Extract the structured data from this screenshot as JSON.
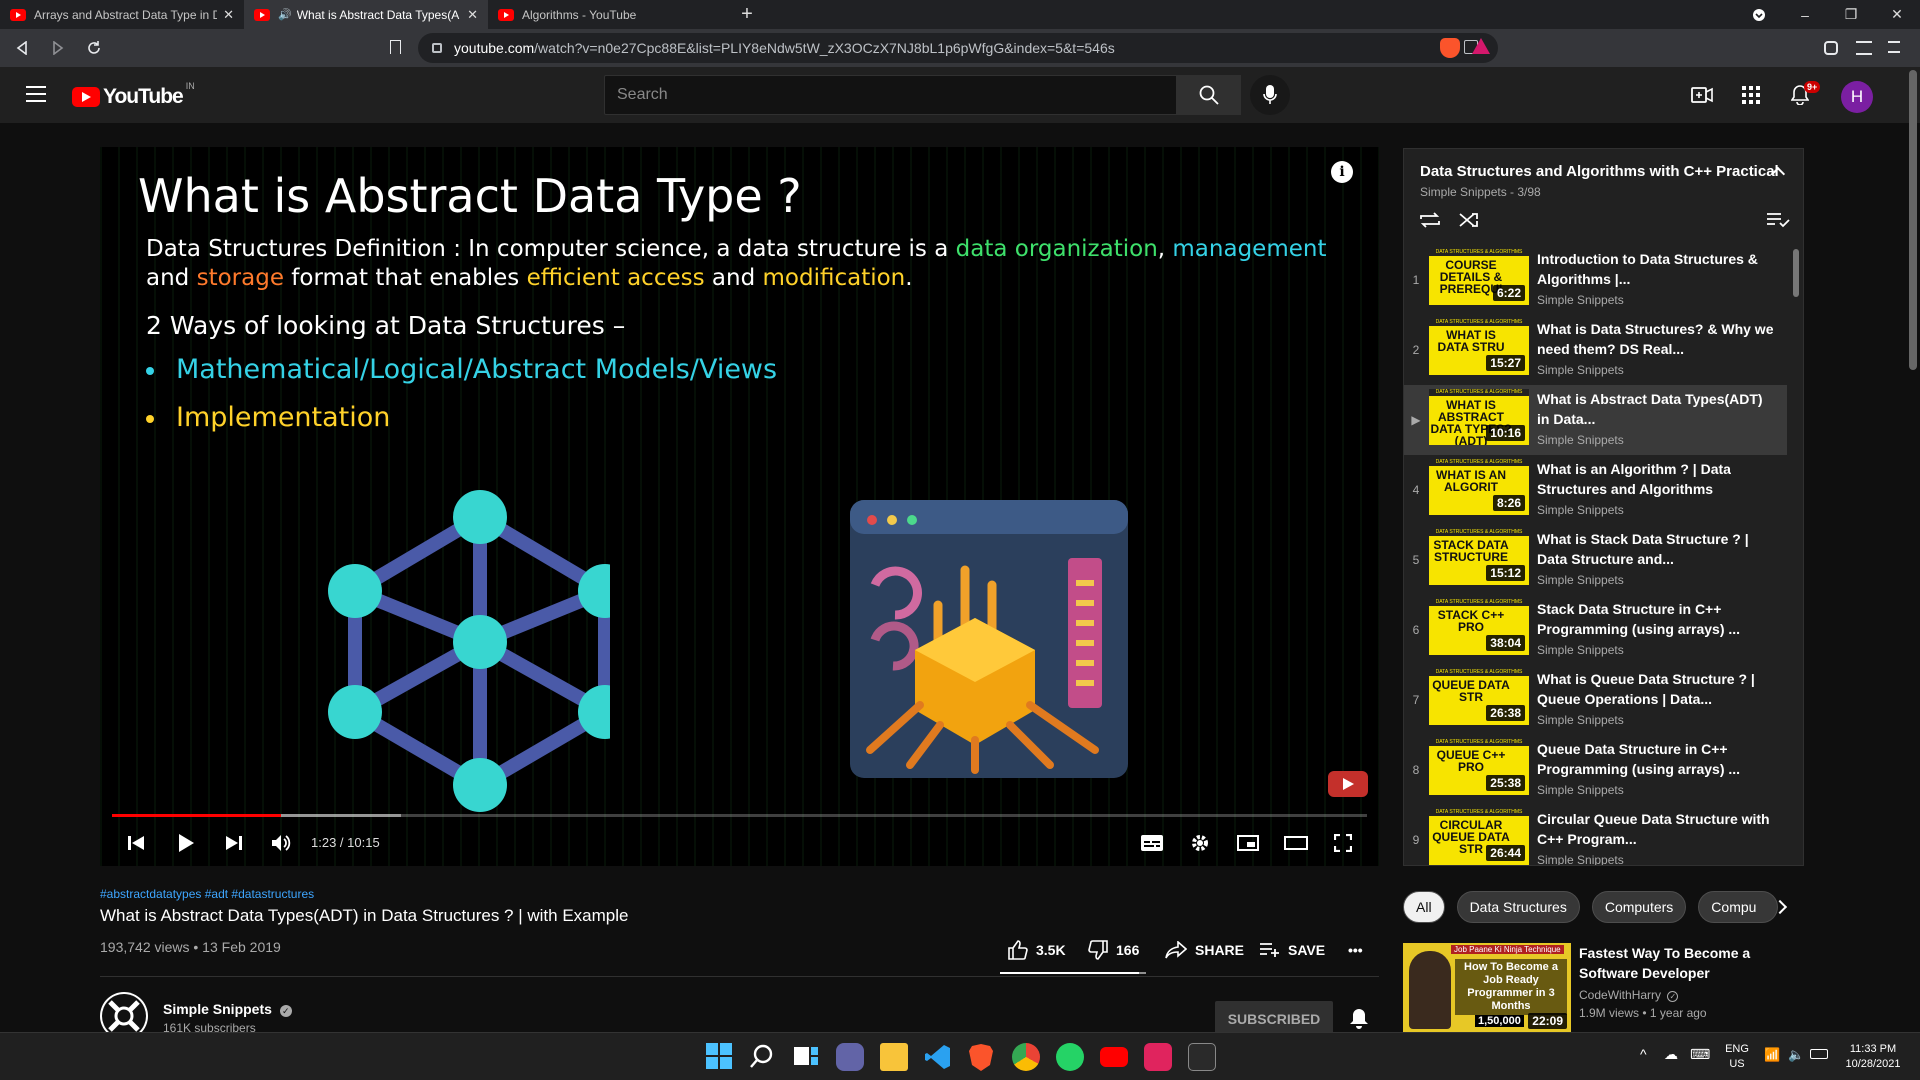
{
  "browser": {
    "tabs": [
      {
        "title": "Arrays and Abstract Data Type in Data",
        "active": false,
        "audio": false
      },
      {
        "title": "What is Abstract Data Types(A",
        "active": true,
        "audio": true
      },
      {
        "title": "Algorithms - YouTube",
        "active": false,
        "audio": false
      }
    ],
    "new_tab": "+",
    "url_host": "youtube.com",
    "url_path": "/watch?v=n0e27Cpc88E&list=PLIY8eNdw5tW_zX3OCzX7NJ8bL1p6pWfgG&index=5&t=546s"
  },
  "header": {
    "logo_text": "YouTube",
    "country_code": "IN",
    "search_placeholder": "Search",
    "notification_count": "9+",
    "avatar_letter": "H"
  },
  "slide": {
    "title": "What is Abstract Data Type ?",
    "def_prefix": "Data Structures Definition : In computer science, a data structure is a ",
    "def_org": "data organization",
    "def_comma": ", ",
    "def_mgmt": "management",
    "def_and1": " and ",
    "def_storage": "storage",
    "def_mid": " format that enables ",
    "def_eff": "efficient access",
    "def_and2": " and ",
    "def_mod": "modification",
    "def_end": ".",
    "ways": "2 Ways of looking at Data Structures –",
    "bullets": [
      "Mathematical/Logical/Abstract Models/Views",
      "Implementation"
    ],
    "colors": {
      "green": "#3ee06b",
      "cyan": "#35d2e6",
      "orange": "#ff7a2c",
      "yellow": "#ffd22a"
    }
  },
  "player": {
    "current_time": "1:23",
    "duration": "10:15",
    "time_display": "1:23 / 10:15",
    "progress_fraction": 0.135,
    "buffered_fraction": 0.23
  },
  "video": {
    "hashtags": "#abstractdatatypes #adt #datastructures",
    "title": "What is Abstract Data Types(ADT) in Data Structures ? | with Example",
    "views_date": "193,742 views • 13 Feb 2019",
    "likes": "3.5K",
    "dislikes": "166",
    "share_label": "SHARE",
    "save_label": "SAVE",
    "like_fraction": 0.95
  },
  "channel": {
    "name": "Simple Snippets",
    "subscribers": "161K subscribers",
    "subscribe_label": "SUBSCRIBED"
  },
  "playlist": {
    "title": "Data Structures and Algorithms with C++ Practical",
    "subtitle": "Simple Snippets - 3/98",
    "items": [
      {
        "index": "1",
        "title": "Introduction to Data Structures & Algorithms |...",
        "channel": "Simple Snippets",
        "duration": "6:22",
        "thumb_text": "COURSE DETAILS & PREREQUI",
        "current": false
      },
      {
        "index": "2",
        "title": "What is Data Structures? & Why we need them? DS Real...",
        "channel": "Simple Snippets",
        "duration": "15:27",
        "thumb_text": "WHAT IS DATA STRU",
        "current": false
      },
      {
        "index": "▶",
        "title": "What is Abstract Data Types(ADT) in Data...",
        "channel": "Simple Snippets",
        "duration": "10:16",
        "thumb_text": "WHAT IS ABSTRACT DATA TYPES? (ADT)",
        "current": true
      },
      {
        "index": "4",
        "title": "What is an Algorithm ? | Data Structures and Algorithms",
        "channel": "Simple Snippets",
        "duration": "8:26",
        "thumb_text": "WHAT IS AN ALGORIT",
        "current": false
      },
      {
        "index": "5",
        "title": "What is Stack Data Structure ? | Data Structure and...",
        "channel": "Simple Snippets",
        "duration": "15:12",
        "thumb_text": "STACK DATA STRUCTURE",
        "current": false
      },
      {
        "index": "6",
        "title": "Stack Data Structure in C++ Programming (using arrays) ...",
        "channel": "Simple Snippets",
        "duration": "38:04",
        "thumb_text": "STACK C++ PRO",
        "current": false
      },
      {
        "index": "7",
        "title": "What is Queue Data Structure ? | Queue Operations | Data...",
        "channel": "Simple Snippets",
        "duration": "26:38",
        "thumb_text": "QUEUE DATA STR",
        "current": false
      },
      {
        "index": "8",
        "title": "Queue Data Structure in C++ Programming (using arrays) ...",
        "channel": "Simple Snippets",
        "duration": "25:38",
        "thumb_text": "QUEUE C++ PRO",
        "current": false
      },
      {
        "index": "9",
        "title": "Circular Queue Data Structure with C++ Program...",
        "channel": "Simple Snippets",
        "duration": "26:44",
        "thumb_text": "CIRCULAR QUEUE DATA STR",
        "current": false
      }
    ]
  },
  "chips": [
    "All",
    "Data Structures",
    "Computers",
    "Compu"
  ],
  "recommended": {
    "title": "Fastest Way To Become a Software Developer",
    "channel": "CodeWithHarry",
    "meta": "1.9M views • 1 year ago",
    "duration": "22:09",
    "thumb_top": "Job Paane Ki Ninja Technique",
    "thumb_text": "How To Become a Job Ready Programmer in 3 Months",
    "thumb_count": "1,50,000"
  },
  "taskbar": {
    "lang": "ENG",
    "region": "US",
    "time": "11:33 PM",
    "date": "10/28/2021"
  }
}
